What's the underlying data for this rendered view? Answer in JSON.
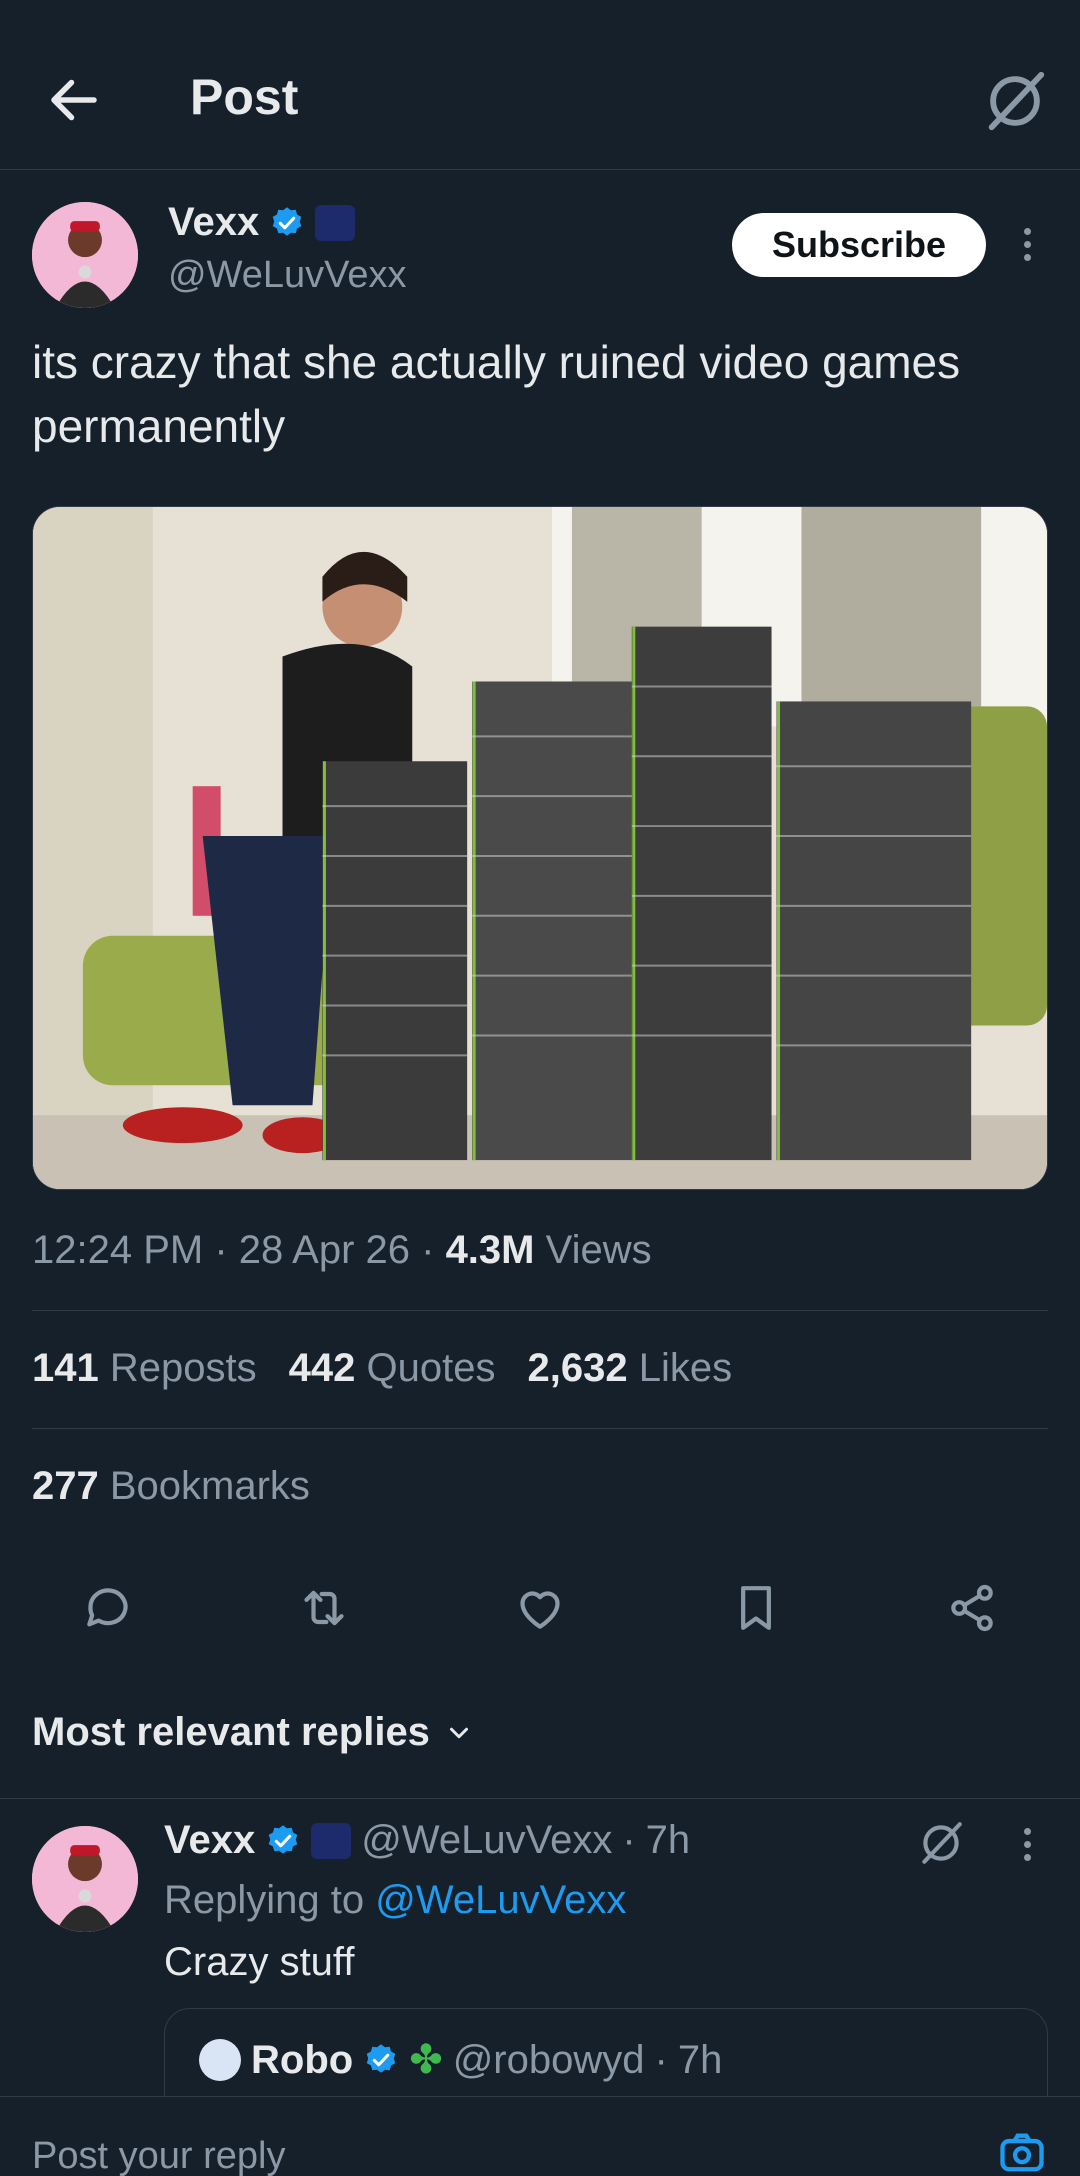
{
  "header": {
    "title": "Post"
  },
  "post": {
    "author_name": "Vexx",
    "author_handle": "@WeLuvVexx",
    "subscribe_label": "Subscribe",
    "text": "its crazy that she actually ruined video games permanently",
    "time": "12:24 PM",
    "date": "28 Apr 26",
    "views_count": "4.3M",
    "views_label": "Views",
    "reposts_count": "141",
    "reposts_label": "Reposts",
    "quotes_count": "442",
    "quotes_label": "Quotes",
    "likes_count": "2,632",
    "likes_label": "Likes",
    "bookmarks_count": "277",
    "bookmarks_label": "Bookmarks"
  },
  "sort_label": "Most relevant replies",
  "reply": {
    "author_name": "Vexx",
    "author_handle": "@WeLuvVexx",
    "time": "7h",
    "replying_prefix": "Replying to",
    "replying_to": "@WeLuvVexx",
    "text": "Crazy stuff"
  },
  "quoted": {
    "author_name": "Robo",
    "author_handle": "@robowyd",
    "time": "7h"
  },
  "composer": {
    "placeholder": "Post your reply"
  },
  "colors": {
    "background": "#15202b",
    "accent": "#1d9bf0",
    "muted": "#8b98a5",
    "text": "#e7e9ea"
  },
  "icons": [
    "back-arrow-icon",
    "grok-icon",
    "verified-icon",
    "more-icon",
    "reply-icon",
    "repost-icon",
    "like-icon",
    "bookmark-icon",
    "share-icon",
    "chevron-down-icon",
    "camera-icon"
  ]
}
